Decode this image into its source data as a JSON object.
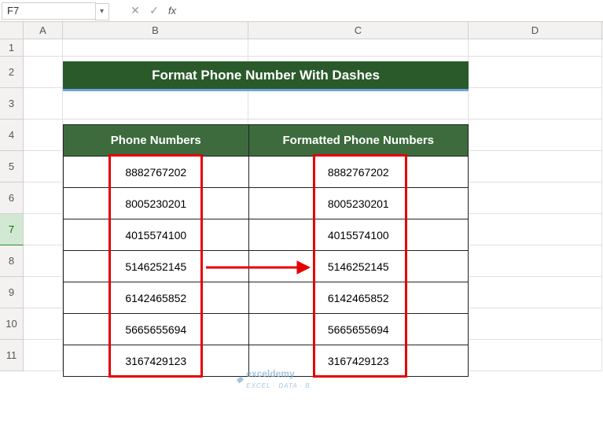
{
  "name_box": "F7",
  "formula_value": "",
  "col_headers": [
    "A",
    "B",
    "C",
    "D"
  ],
  "row_headers": [
    "1",
    "2",
    "3",
    "4",
    "5",
    "6",
    "7",
    "8",
    "9",
    "10",
    "11"
  ],
  "selected_row": "7",
  "title": "Format Phone Number With Dashes",
  "table": {
    "header_b": "Phone Numbers",
    "header_c": "Formatted Phone Numbers",
    "rows": [
      {
        "b": "8882767202",
        "c": "8882767202"
      },
      {
        "b": "8005230201",
        "c": "8005230201"
      },
      {
        "b": "4015574100",
        "c": "4015574100"
      },
      {
        "b": "5146252145",
        "c": "5146252145"
      },
      {
        "b": "6142465852",
        "c": "6142465852"
      },
      {
        "b": "5665655694",
        "c": "5665655694"
      },
      {
        "b": "3167429123",
        "c": "3167429123"
      }
    ]
  },
  "watermark": {
    "brand": "exceldemy",
    "sub": "EXCEL · DATA · B"
  },
  "colors": {
    "header_green": "#3d6b3d",
    "title_green": "#2a5a2a",
    "title_underline": "#6ba6d8",
    "annotation_red": "#e60000"
  },
  "chart_data": {
    "type": "table",
    "title": "Format Phone Number With Dashes",
    "columns": [
      "Phone Numbers",
      "Formatted Phone Numbers"
    ],
    "rows": [
      [
        "8882767202",
        "8882767202"
      ],
      [
        "8005230201",
        "8005230201"
      ],
      [
        "4015574100",
        "4015574100"
      ],
      [
        "5146252145",
        "5146252145"
      ],
      [
        "6142465852",
        "6142465852"
      ],
      [
        "5665655694",
        "5665655694"
      ],
      [
        "3167429123",
        "3167429123"
      ]
    ]
  }
}
